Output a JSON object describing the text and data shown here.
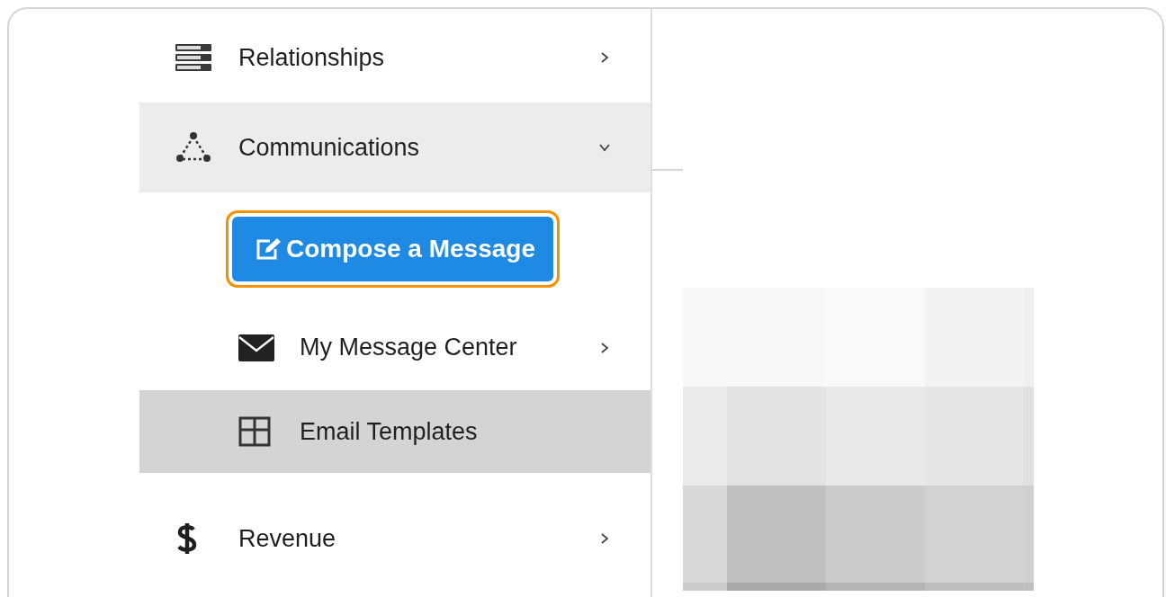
{
  "sidebar": {
    "items": [
      {
        "label": "Relationships",
        "kind": "section",
        "expanded": false,
        "selected": false
      },
      {
        "label": "Communications",
        "kind": "section",
        "expanded": true,
        "selected": true,
        "children": [
          {
            "label": "Compose a Message",
            "kind": "button",
            "focused": true
          },
          {
            "label": "My Message Center",
            "kind": "link",
            "has_submenu": true,
            "selected": false
          },
          {
            "label": "Email Templates",
            "kind": "link",
            "has_submenu": false,
            "selected": true
          }
        ]
      },
      {
        "label": "Revenue",
        "kind": "section",
        "expanded": false,
        "selected": false
      }
    ]
  }
}
